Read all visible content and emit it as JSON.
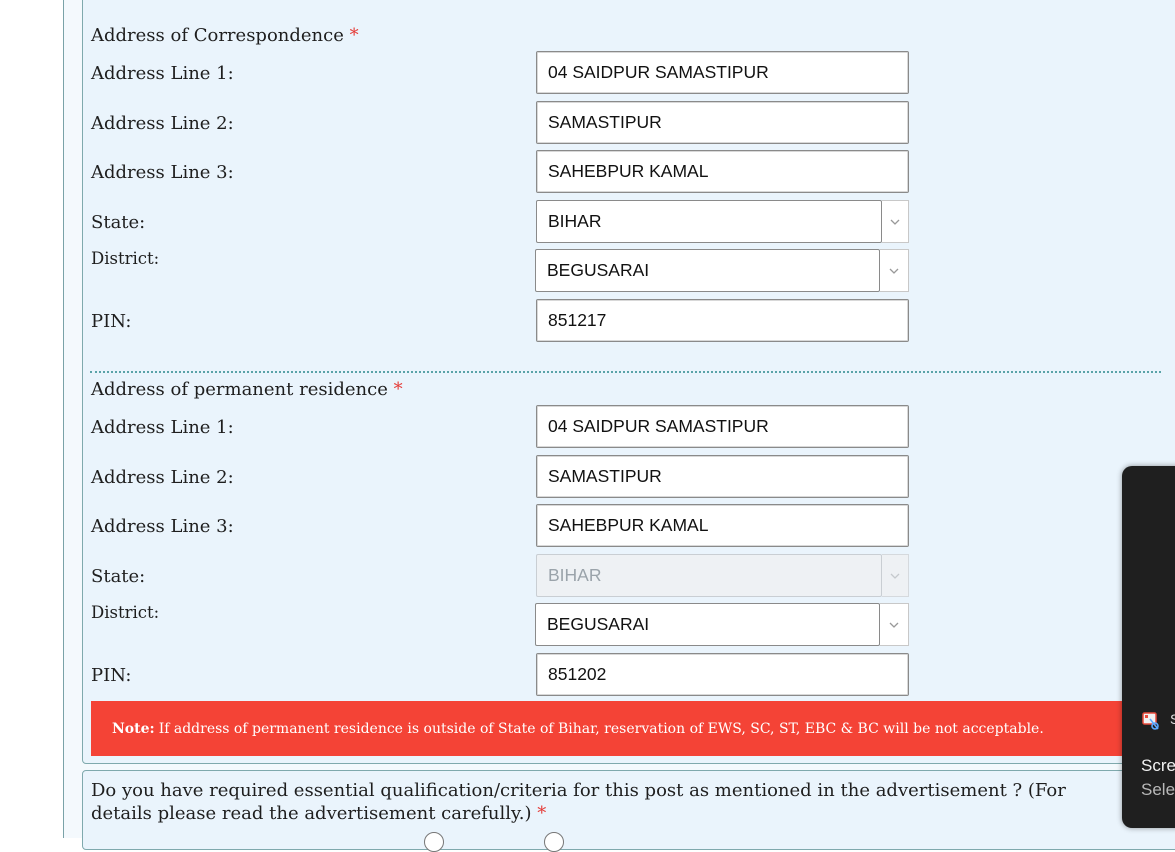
{
  "correspondence": {
    "title": "Address of Correspondence",
    "required_mark": "*",
    "line1_label": "Address Line 1:",
    "line1_value": "04 SAIDPUR SAMASTIPUR",
    "line2_label": "Address Line 2:",
    "line2_value": "SAMASTIPUR",
    "line3_label": "Address Line 3:",
    "line3_value": "SAHEBPUR KAMAL",
    "state_label": "State:",
    "state_value": "BIHAR",
    "district_label": "District:",
    "district_value": "BEGUSARAI",
    "pin_label": "PIN:",
    "pin_value": "851217"
  },
  "permanent": {
    "title": "Address of permanent residence",
    "required_mark": "*",
    "line1_label": "Address Line 1:",
    "line1_value": "04 SAIDPUR SAMASTIPUR",
    "line2_label": "Address Line 2:",
    "line2_value": "SAMASTIPUR",
    "line3_label": "Address Line 3:",
    "line3_value": "SAHEBPUR KAMAL",
    "state_label": "State:",
    "state_value": "BIHAR",
    "district_label": "District:",
    "district_value": "BEGUSARAI",
    "pin_label": "PIN:",
    "pin_value": "851202"
  },
  "note": {
    "label": "Note:",
    "text": "If address of permanent residence is outside of State of Bihar, reservation of EWS, SC, ST, EBC & BC will be not acceptable."
  },
  "qualification": {
    "question": "Do you have required essential qualification/criteria for this post as mentioned in the advertisement ? (For details please read the advertisement carefully.)",
    "required_mark": "*"
  },
  "notification": {
    "app_icon": "snipping-tool-icon",
    "app_name": "S",
    "title": "Scre",
    "subtitle": "Selec"
  },
  "colors": {
    "panel_bg": "#eaf4fc",
    "note_bg": "#f44336",
    "required": "#e53935",
    "divider": "#5aa3a8"
  }
}
